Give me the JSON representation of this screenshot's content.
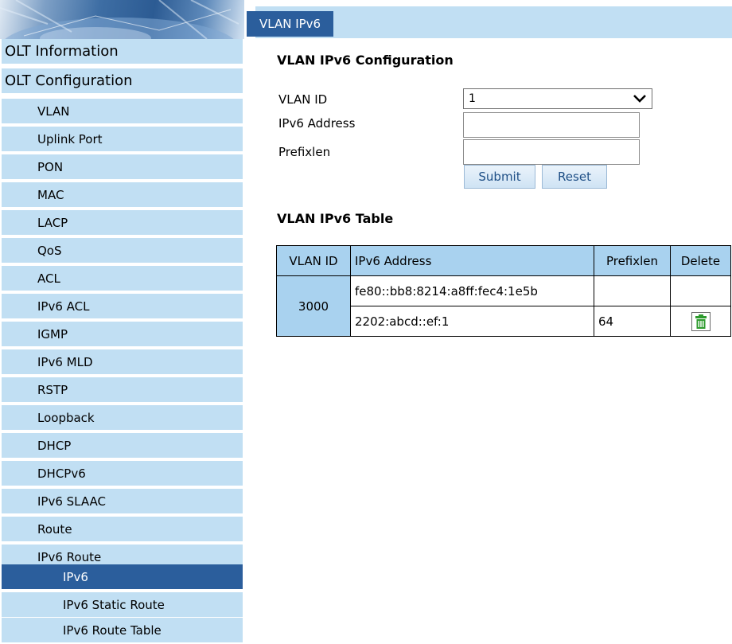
{
  "sidebar": {
    "items": [
      {
        "label": "OLT Information"
      },
      {
        "label": "OLT Configuration"
      },
      {
        "label": "VLAN"
      },
      {
        "label": "Uplink Port"
      },
      {
        "label": "PON"
      },
      {
        "label": "MAC"
      },
      {
        "label": "LACP"
      },
      {
        "label": "QoS"
      },
      {
        "label": "ACL"
      },
      {
        "label": "IPv6 ACL"
      },
      {
        "label": "IGMP"
      },
      {
        "label": "IPv6 MLD"
      },
      {
        "label": "RSTP"
      },
      {
        "label": "Loopback"
      },
      {
        "label": "DHCP"
      },
      {
        "label": "DHCPv6"
      },
      {
        "label": "IPv6 SLAAC"
      },
      {
        "label": "Route"
      },
      {
        "label": "IPv6 Route"
      },
      {
        "label": "IPv6"
      },
      {
        "label": "IPv6 Static Route"
      },
      {
        "label": "IPv6 Route Table"
      }
    ]
  },
  "tabs": {
    "active": "VLAN IPv6"
  },
  "config": {
    "title": "VLAN IPv6 Configuration",
    "vlan_id_label": "VLAN ID",
    "vlan_id_value": "1",
    "ipv6_address_label": "IPv6 Address",
    "ipv6_address_value": "",
    "prefixlen_label": "Prefixlen",
    "prefixlen_value": "",
    "submit_label": "Submit",
    "reset_label": "Reset"
  },
  "table": {
    "title": "VLAN IPv6 Table",
    "headers": [
      "VLAN ID",
      "IPv6 Address",
      "Prefixlen",
      "Delete"
    ],
    "groups": [
      {
        "vlan_id": "3000",
        "rows": [
          {
            "address": "fe80::bb8:8214:a8ff:fec4:1e5b",
            "prefixlen": "",
            "deletable": false
          },
          {
            "address": "2202:abcd::ef:1",
            "prefixlen": "64",
            "deletable": true
          }
        ]
      }
    ]
  },
  "colors": {
    "nav_background": "#c1dff3",
    "nav_active": "#2b5e9c",
    "table_header": "#a9d2ef",
    "trash_icon": "#2e9b2e"
  },
  "icons": {
    "select_arrow": "chevron-down-icon",
    "delete": "trash-icon"
  }
}
